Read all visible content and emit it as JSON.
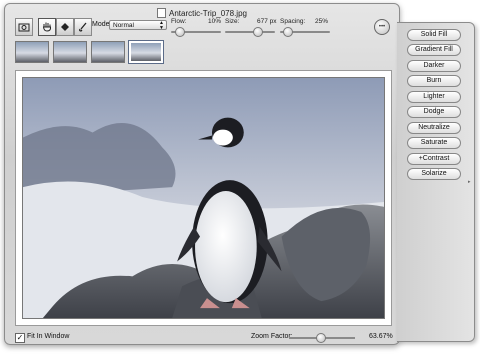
{
  "window": {
    "title": "Antarctic-Trip_078.jpg"
  },
  "toolbar": {
    "mode_label": "Mode:",
    "mode_value": "Normal",
    "flow_label": "Flow:",
    "flow_value": "10%",
    "size_label": "Size:",
    "size_value": "677 px",
    "spacing_label": "Spacing:",
    "spacing_value": "25%",
    "action_glyph": "•••"
  },
  "tools": [
    {
      "icon": "camera-icon"
    },
    {
      "icon": "hand-icon"
    },
    {
      "icon": "stamp-icon"
    },
    {
      "icon": "brush-icon"
    }
  ],
  "thumbnails": [
    {
      "selected": false
    },
    {
      "selected": false
    },
    {
      "selected": false
    },
    {
      "selected": true
    }
  ],
  "footer": {
    "fit_label": "Fit In Window",
    "fit_checked": true,
    "zoom_label": "Zoom Factor:",
    "zoom_value": "63.67%"
  },
  "effects": [
    "Solid Fill",
    "Gradient Fill",
    "Darker",
    "Burn",
    "Lighter",
    "Dodge",
    "Neutralize",
    "Saturate",
    "+Contrast",
    "Solarize"
  ]
}
